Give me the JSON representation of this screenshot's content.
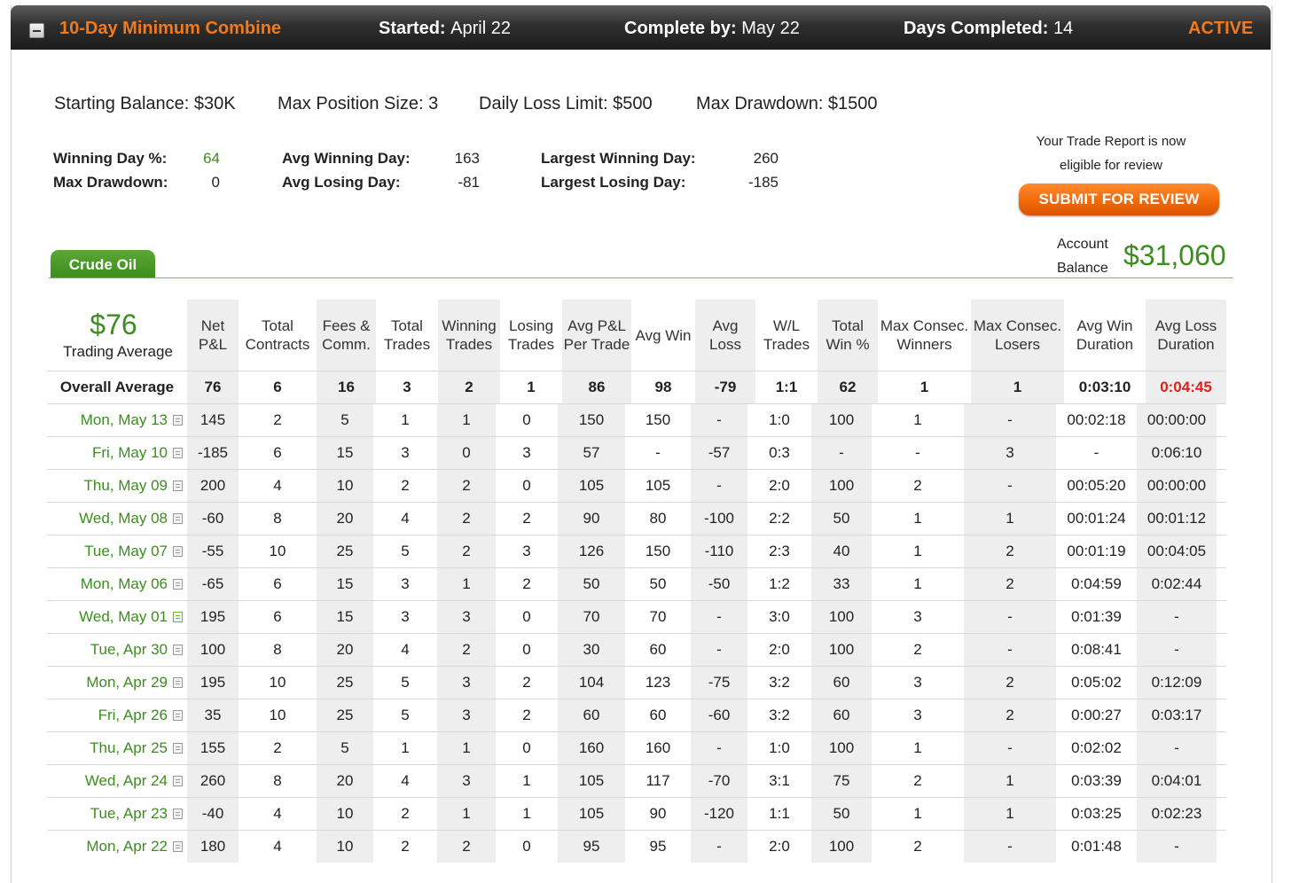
{
  "header": {
    "title": "10-Day Minimum Combine",
    "started_label": "Started:",
    "started_value": "April 22",
    "complete_label": "Complete by:",
    "complete_value": "May 22",
    "days_label": "Days Completed:",
    "days_value": "14",
    "status": "ACTIVE"
  },
  "summary": {
    "starting_balance": "Starting Balance: $30K",
    "max_position": "Max Position Size: 3",
    "daily_loss": "Daily Loss Limit: $500",
    "max_drawdown": "Max Drawdown: $1500"
  },
  "stats": {
    "winning_day_pct_label": "Winning Day %:",
    "winning_day_pct": "64",
    "max_drawdown_label": "Max Drawdown:",
    "max_drawdown": "0",
    "avg_winning_day_label": "Avg Winning Day:",
    "avg_winning_day": "163",
    "avg_losing_day_label": "Avg Losing Day:",
    "avg_losing_day": "-81",
    "largest_winning_day_label": "Largest Winning Day:",
    "largest_winning_day": "260",
    "largest_losing_day_label": "Largest Losing Day:",
    "largest_losing_day": "-185"
  },
  "review": {
    "line1": "Your Trade Report is now",
    "line2": "eligible for review",
    "button": "SUBMIT FOR REVIEW"
  },
  "account": {
    "label1": "Account",
    "label2": "Balance",
    "value": "$31,060"
  },
  "tab": {
    "label": "Crude Oil"
  },
  "table": {
    "avg_value": "$76",
    "avg_label": "Trading Average",
    "columns": [
      "Net P&L",
      "Total Contracts",
      "Fees & Comm.",
      "Total Trades",
      "Winning Trades",
      "Losing Trades",
      "Avg P&L Per Trade",
      "Avg Win",
      "Avg Loss",
      "W/L Trades",
      "Total Win %",
      "Max Consec. Winners",
      "Max Consec. Losers",
      "Avg Win Duration",
      "Avg Loss Duration"
    ],
    "overall": {
      "label": "Overall Average",
      "values": [
        "76",
        "6",
        "16",
        "3",
        "2",
        "1",
        "86",
        "98",
        "-79",
        "1:1",
        "62",
        "1",
        "1",
        "0:03:10",
        "0:04:45"
      ]
    },
    "rows": [
      {
        "date": "Mon, May 13",
        "values": [
          "145",
          "2",
          "5",
          "1",
          "1",
          "0",
          "150",
          "150",
          "-",
          "1:0",
          "100",
          "1",
          "-",
          "00:02:18",
          "00:00:00"
        ]
      },
      {
        "date": "Fri, May 10",
        "values": [
          "-185",
          "6",
          "15",
          "3",
          "0",
          "3",
          "57",
          "-",
          "-57",
          "0:3",
          "-",
          "-",
          "3",
          "-",
          "0:06:10"
        ]
      },
      {
        "date": "Thu, May 09",
        "values": [
          "200",
          "4",
          "10",
          "2",
          "2",
          "0",
          "105",
          "105",
          "-",
          "2:0",
          "100",
          "2",
          "-",
          "00:05:20",
          "00:00:00"
        ]
      },
      {
        "date": "Wed, May 08",
        "values": [
          "-60",
          "8",
          "20",
          "4",
          "2",
          "2",
          "90",
          "80",
          "-100",
          "2:2",
          "50",
          "1",
          "1",
          "00:01:24",
          "00:01:12"
        ]
      },
      {
        "date": "Tue, May 07",
        "values": [
          "-55",
          "10",
          "25",
          "5",
          "2",
          "3",
          "126",
          "150",
          "-110",
          "2:3",
          "40",
          "1",
          "2",
          "00:01:19",
          "00:04:05"
        ]
      },
      {
        "date": "Mon, May 06",
        "values": [
          "-65",
          "6",
          "15",
          "3",
          "1",
          "2",
          "50",
          "50",
          "-50",
          "1:2",
          "33",
          "1",
          "2",
          "0:04:59",
          "0:02:44"
        ]
      },
      {
        "date": "Wed, May 01",
        "values": [
          "195",
          "6",
          "15",
          "3",
          "3",
          "0",
          "70",
          "70",
          "-",
          "3:0",
          "100",
          "3",
          "-",
          "0:01:39",
          "-"
        ]
      },
      {
        "date": "Tue, Apr 30",
        "values": [
          "100",
          "8",
          "20",
          "4",
          "2",
          "0",
          "30",
          "60",
          "-",
          "2:0",
          "100",
          "2",
          "-",
          "0:08:41",
          "-"
        ]
      },
      {
        "date": "Mon, Apr 29",
        "values": [
          "195",
          "10",
          "25",
          "5",
          "3",
          "2",
          "104",
          "123",
          "-75",
          "3:2",
          "60",
          "3",
          "2",
          "0:05:02",
          "0:12:09"
        ]
      },
      {
        "date": "Fri, Apr 26",
        "values": [
          "35",
          "10",
          "25",
          "5",
          "3",
          "2",
          "60",
          "60",
          "-60",
          "3:2",
          "60",
          "3",
          "2",
          "0:00:27",
          "0:03:17"
        ]
      },
      {
        "date": "Thu, Apr 25",
        "values": [
          "155",
          "2",
          "5",
          "1",
          "1",
          "0",
          "160",
          "160",
          "-",
          "1:0",
          "100",
          "1",
          "-",
          "0:02:02",
          "-"
        ]
      },
      {
        "date": "Wed, Apr 24",
        "values": [
          "260",
          "8",
          "20",
          "4",
          "3",
          "1",
          "105",
          "117",
          "-70",
          "3:1",
          "75",
          "2",
          "1",
          "0:03:39",
          "0:04:01"
        ]
      },
      {
        "date": "Tue, Apr 23",
        "values": [
          "-40",
          "4",
          "10",
          "2",
          "1",
          "1",
          "105",
          "90",
          "-120",
          "1:1",
          "50",
          "1",
          "1",
          "0:03:25",
          "0:02:23"
        ]
      },
      {
        "date": "Mon, Apr 22",
        "values": [
          "180",
          "4",
          "10",
          "2",
          "2",
          "0",
          "95",
          "95",
          "-",
          "2:0",
          "100",
          "2",
          "-",
          "0:01:48",
          "-"
        ]
      }
    ]
  },
  "colors": {
    "accent_orange": "#f27a1e",
    "accent_green": "#3c8d1f",
    "negative_red": "#e0201b"
  }
}
